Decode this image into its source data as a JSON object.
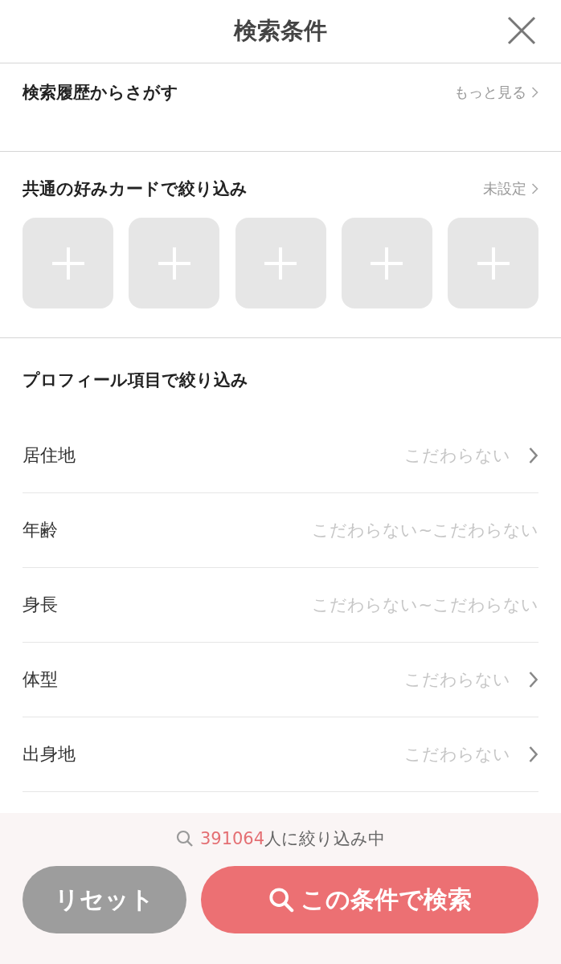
{
  "header": {
    "title": "検索条件"
  },
  "history": {
    "title": "検索履歴からさがす",
    "link": "もっと見る"
  },
  "cards_section": {
    "title": "共通の好みカードで絞り込み",
    "status": "未設定",
    "cards": [
      {
        "kind": "add"
      },
      {
        "kind": "add"
      },
      {
        "kind": "add"
      },
      {
        "kind": "add"
      },
      {
        "kind": "add"
      }
    ]
  },
  "profile": {
    "title": "プロフィール項目で絞り込み",
    "rows": [
      {
        "label": "居住地",
        "value": "こだわらない",
        "chevron": true
      },
      {
        "label": "年齢",
        "value": "こだわらない~こだわらない",
        "chevron": false
      },
      {
        "label": "身長",
        "value": "こだわらない~こだわらない",
        "chevron": false
      },
      {
        "label": "体型",
        "value": "こだわらない",
        "chevron": true
      },
      {
        "label": "出身地",
        "value": "こだわらない",
        "chevron": true
      }
    ]
  },
  "footer": {
    "count": "391064",
    "count_suffix": "人に絞り込み中",
    "reset": "リセット",
    "search": "この条件で検索"
  }
}
